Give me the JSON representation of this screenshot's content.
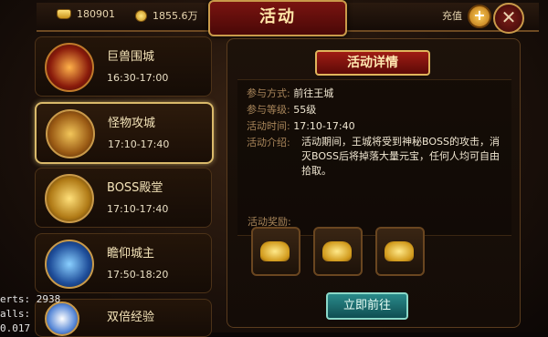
{
  "window": {
    "title": "活动"
  },
  "resources": {
    "ingot_amount": "180901",
    "gold_amount": "1855.6万"
  },
  "header": {
    "recharge_label": "充值",
    "plus_symbol": "+",
    "close_symbol": "✕"
  },
  "activities": [
    {
      "name": "巨兽围城",
      "time": "16:30-17:00"
    },
    {
      "name": "怪物攻城",
      "time": "17:10-17:40"
    },
    {
      "name": "BOSS殿堂",
      "time": "17:10-17:40"
    },
    {
      "name": "瞻仰城主",
      "time": "17:50-18:20"
    },
    {
      "name": "双倍经验",
      "time": ""
    }
  ],
  "detail": {
    "title": "活动详情",
    "participation_label": "参与方式:",
    "participation_value": "前往王城",
    "level_label": "参与等级:",
    "level_value": "55级",
    "time_label": "活动时间:",
    "time_value": "17:10-17:40",
    "intro_label": "活动介绍:",
    "intro_value": "活动期间，王城将受到神秘BOSS的攻击，消灭BOSS后将掉落大量元宝，任何人均可自由拾取。",
    "reward_label": "活动奖励:",
    "go_button": "立即前往"
  },
  "debug": {
    "line1": "erts: 2938",
    "line2": "alls:",
    "line3": "0.017"
  }
}
